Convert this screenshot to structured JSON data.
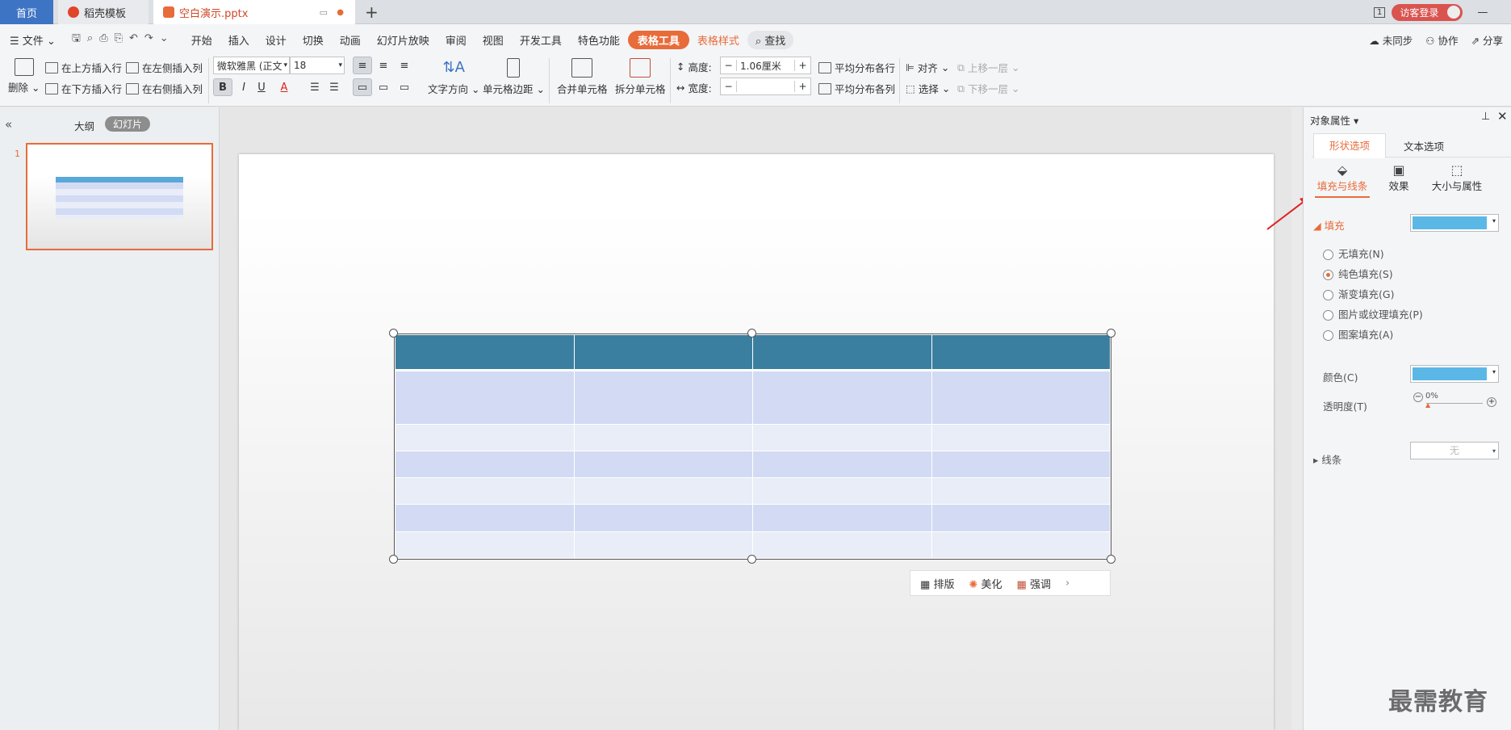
{
  "tabs": {
    "home": "首页",
    "template": "稻壳模板",
    "file": "空白演示.pptx",
    "add": "+"
  },
  "titlebar": {
    "page_badge": "1",
    "login": "访客登录",
    "minimize": "—"
  },
  "menu": {
    "file": "文件",
    "items": [
      "开始",
      "插入",
      "设计",
      "切换",
      "动画",
      "幻灯片放映",
      "审阅",
      "视图",
      "开发工具",
      "特色功能"
    ],
    "table_tools": "表格工具",
    "table_style": "表格样式",
    "search": "查找",
    "sync": "未同步",
    "collab": "协作",
    "share": "分享"
  },
  "ribbon": {
    "delete": "删除",
    "insert_above": "在上方插入行",
    "insert_below": "在下方插入行",
    "insert_left": "在左侧插入列",
    "insert_right": "在右侧插入列",
    "font": "微软雅黑 (正文",
    "font_size": "18",
    "text_dir": "文字方向",
    "cell_margin": "单元格边距",
    "merge": "合并单元格",
    "split": "拆分单元格",
    "height_label": "高度:",
    "height_value": "1.06厘米",
    "width_label": "宽度:",
    "width_value": "",
    "dist_rows": "平均分布各行",
    "dist_cols": "平均分布各列",
    "align": "对齐",
    "select": "选择",
    "bring_forward": "上移一层",
    "send_backward": "下移一层"
  },
  "left": {
    "outline": "大纲",
    "slides": "幻灯片",
    "slide_num": "1"
  },
  "float": {
    "layout": "排版",
    "beautify": "美化",
    "emphasis": "强调"
  },
  "props": {
    "title": "对象属性",
    "tab_shape": "形状选项",
    "tab_text": "文本选项",
    "sub_fill": "填充与线条",
    "sub_effect": "效果",
    "sub_size": "大小与属性",
    "fill": "填充",
    "opt_none": "无填充(N)",
    "opt_solid": "纯色填充(S)",
    "opt_gradient": "渐变填充(G)",
    "opt_picture": "图片或纹理填充(P)",
    "opt_pattern": "图案填充(A)",
    "color": "颜色(C)",
    "transparency": "透明度(T)",
    "transparency_value": "0%",
    "line": "线条",
    "line_value": "无",
    "fill_color": "#5bb8e6"
  },
  "watermark": "最需教育",
  "colors": {
    "accent": "#e86b3a",
    "header": "#3b7fa0",
    "row_dark": "#d2dbf3",
    "row_light": "#e8edf8"
  }
}
